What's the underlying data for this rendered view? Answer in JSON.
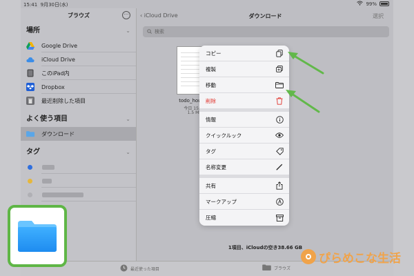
{
  "status": {
    "time": "15:41",
    "date": "9月30日(水)",
    "battery": "99%"
  },
  "sidebar": {
    "title": "ブラウズ",
    "more": "···",
    "locations_title": "場所",
    "locations": [
      {
        "label": "Google Drive",
        "icon": "google-drive-icon"
      },
      {
        "label": "iCloud Drive",
        "icon": "icloud-icon"
      },
      {
        "label": "このiPad内",
        "icon": "ipad-icon"
      },
      {
        "label": "Dropbox",
        "icon": "dropbox-icon"
      },
      {
        "label": "最近削除した項目",
        "icon": "trash-icon"
      }
    ],
    "favorites_title": "よく使う項目",
    "favorites": [
      {
        "label": "ダウンロード",
        "icon": "folder-icon"
      }
    ],
    "tags_title": "タグ",
    "tag_colors": [
      "#2f6fde",
      "#e6b73c",
      "#b0b0b5"
    ]
  },
  "main": {
    "back_label": "iCloud Drive",
    "title": "ダウンロード",
    "select_label": "選択",
    "search_placeholder": "検索",
    "file": {
      "name": "todo_hougan",
      "date": "今日 15:27",
      "size": "1.5 MB"
    },
    "summary": "1項目、iCloudの空き38.66 GB"
  },
  "menu": {
    "items": [
      {
        "label": "コピー",
        "icon": "copy-icon"
      },
      {
        "label": "複製",
        "icon": "duplicate-icon"
      },
      {
        "label": "移動",
        "icon": "folder-icon"
      },
      {
        "label": "削除",
        "icon": "trash-icon",
        "destructive": true
      },
      {
        "label": "情報",
        "icon": "info-icon"
      },
      {
        "label": "クイックルック",
        "icon": "eye-icon"
      },
      {
        "label": "タグ",
        "icon": "tag-icon"
      },
      {
        "label": "名称変更",
        "icon": "pencil-icon"
      },
      {
        "label": "共有",
        "icon": "share-icon"
      },
      {
        "label": "マークアップ",
        "icon": "markup-icon"
      },
      {
        "label": "圧縮",
        "icon": "archive-icon"
      }
    ]
  },
  "tabbar": {
    "recent_label": "最近使った項目",
    "browse_label": "ブラウズ"
  },
  "colors": {
    "accent_green": "#5fb646",
    "destructive_red": "#e0322b",
    "files_blue": "#1e8cf0",
    "watermark_orange": "#f0a34a"
  },
  "watermark": {
    "text": "ぴらめこな生活"
  }
}
